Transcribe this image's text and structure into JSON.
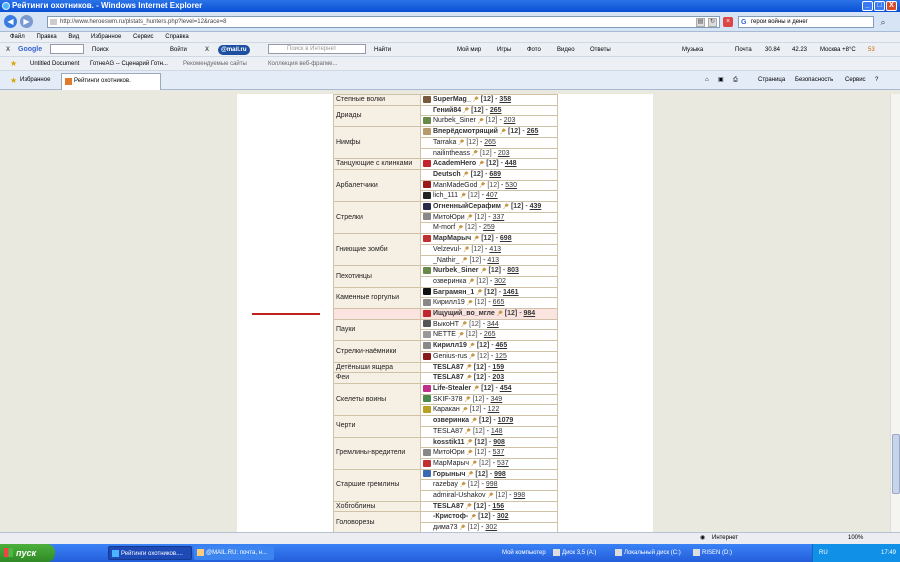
{
  "window": {
    "title": "Рейтинги охотников. - Windows Internet Explorer",
    "min": "_",
    "max": "□",
    "close": "X"
  },
  "address": {
    "url": "http://www.heroeswm.ru/plstats_hunters.php?level=12&race=8",
    "search_value": "герои войны и денег",
    "search_engine_glyph": "G"
  },
  "menu": [
    "Файл",
    "Правка",
    "Вид",
    "Избранное",
    "Сервис",
    "Справка"
  ],
  "toolbar1": {
    "close_glyph": "X",
    "google": "Google",
    "poisk": "Поиск",
    "voiti": "Войти",
    "mailru": "@mail.ru",
    "search_placeholder": "Поиск в Интернет",
    "naiti": "Найти",
    "moi_mir": "Мой мир",
    "igry": "Игры",
    "foto": "Фото",
    "video": "Видео",
    "otvety": "Ответы"
  },
  "toolbar2": {
    "muzyka": "Музыка",
    "pochta": "Почта",
    "temp1": "30.84",
    "temp2": "42.23",
    "moskva": "Москва +8°C",
    "num": "53"
  },
  "bookmarks": [
    "Untitled Document",
    "ГотнеАG -- Сценарий Готн...",
    "Рекомендуемые сайты",
    "Коллекция веб-фрагме..."
  ],
  "tabs": {
    "favorites": "Избранное",
    "active": "Рейтинги охотников.",
    "page": "Страница",
    "security": "Безопасность",
    "service": "Сервис"
  },
  "rows": [
    {
      "cls": "Степные волки",
      "nm": "SuperMag_",
      "lv": "[12]",
      "sc": "358",
      "bold": true,
      "span": 1,
      "av": "#7a5a3a"
    },
    {
      "cls": "Дриады",
      "nm": "Гений84",
      "lv": "[12]",
      "sc": "265",
      "bold": true,
      "span": 2,
      "av": ""
    },
    {
      "nm": "Nurbek_Siner",
      "lv": "[12]",
      "sc": "203",
      "bold": false,
      "av": "#6a8a4a"
    },
    {
      "cls": "Нимфы",
      "nm": "Вперёдсмотрящий",
      "lv": "[12]",
      "sc": "265",
      "bold": true,
      "span": 3,
      "av": "#b99a6a"
    },
    {
      "nm": "Tarraka",
      "lv": "[12]",
      "sc": "265",
      "bold": false,
      "av": ""
    },
    {
      "nm": "nailintheass",
      "lv": "[12]",
      "sc": "203",
      "bold": false,
      "av": ""
    },
    {
      "cls": "Танцующие с клинками",
      "nm": "AcademHero",
      "lv": "[12]",
      "sc": "448",
      "bold": true,
      "span": 1,
      "av": "#c0242c"
    },
    {
      "cls": "Арбалетчики",
      "nm": "Deutsch",
      "lv": "[12]",
      "sc": "689",
      "bold": true,
      "span": 3,
      "av": ""
    },
    {
      "nm": "ManMadeGod",
      "lv": "[12]",
      "sc": "530",
      "bold": false,
      "av": "#9a1a1a"
    },
    {
      "nm": "lich_111",
      "lv": "[12]",
      "sc": "407",
      "bold": false,
      "av": "#222222"
    },
    {
      "cls": "Стрелки",
      "nm": "ОгненныйСерафим",
      "lv": "[12]",
      "sc": "439",
      "bold": true,
      "span": 3,
      "av": "#2a2a4a"
    },
    {
      "nm": "МитоЮри",
      "lv": "[12]",
      "sc": "337",
      "bold": false,
      "av": "#888888"
    },
    {
      "nm": "M-morf",
      "lv": "[12]",
      "sc": "259",
      "bold": false,
      "av": ""
    },
    {
      "cls": "Гниющие зомби",
      "nm": "МарМарыч",
      "lv": "[12]",
      "sc": "698",
      "bold": true,
      "span": 3,
      "av": "#c03030"
    },
    {
      "nm": "Velzevul-",
      "lv": "[12]",
      "sc": "413",
      "bold": false,
      "av": ""
    },
    {
      "nm": "_Nathir_",
      "lv": "[12]",
      "sc": "413",
      "bold": false,
      "av": ""
    },
    {
      "cls": "Пехотинцы",
      "nm": "Nurbek_Siner",
      "lv": "[12]",
      "sc": "803",
      "bold": true,
      "span": 2,
      "av": "#6a8a4a"
    },
    {
      "nm": "озверинка",
      "lv": "[12]",
      "sc": "302",
      "bold": false,
      "av": ""
    },
    {
      "cls": "Каменные горгульи",
      "nm": "Баграмян_1",
      "lv": "[12]",
      "sc": "1461",
      "bold": true,
      "span": 2,
      "av": "#111111"
    },
    {
      "nm": "Кирилл19",
      "lv": "[12]",
      "sc": "665",
      "bold": false,
      "av": "#888888"
    },
    {
      "cls": "",
      "nm": "Ищущий_во_мгле",
      "lv": "[12]",
      "sc": "984",
      "bold": true,
      "span": 1,
      "av": "#c0242c",
      "hl": true
    },
    {
      "cls": "Пауки",
      "nm": "ВыкоНТ",
      "lv": "[12]",
      "sc": "344",
      "bold": false,
      "span": 2,
      "av": "#555555"
    },
    {
      "nm": "NETTE",
      "lv": "[12]",
      "sc": "265",
      "bold": false,
      "av": "#999999"
    },
    {
      "cls": "Стрелки-наёмники",
      "nm": "Кирилл19",
      "lv": "[12]",
      "sc": "465",
      "bold": true,
      "span": 2,
      "av": "#888888"
    },
    {
      "nm": "Genius-rus",
      "lv": "[12]",
      "sc": "125",
      "bold": false,
      "av": "#8a1a1a"
    },
    {
      "cls": "Детёныши ящера",
      "nm": "TESLA87",
      "lv": "[12]",
      "sc": "159",
      "bold": true,
      "span": 1,
      "av": ""
    },
    {
      "cls": "Феи",
      "nm": "TESLA87",
      "lv": "[12]",
      "sc": "203",
      "bold": true,
      "span": 1,
      "av": ""
    },
    {
      "cls": "Скелеты воины",
      "nm": "Life-Stealer",
      "lv": "[12]",
      "sc": "454",
      "bold": true,
      "span": 3,
      "av": "#c0308a"
    },
    {
      "nm": "SKIF-378",
      "lv": "[12]",
      "sc": "349",
      "bold": false,
      "av": "#4a8a4a"
    },
    {
      "nm": "Каракан",
      "lv": "[12]",
      "sc": "122",
      "bold": false,
      "av": "#b8a020"
    },
    {
      "cls": "Черти",
      "nm": "озверинка",
      "lv": "[12]",
      "sc": "1079",
      "bold": true,
      "span": 2,
      "av": ""
    },
    {
      "nm": "TESLA87",
      "lv": "[12]",
      "sc": "148",
      "bold": false,
      "av": ""
    },
    {
      "cls": "Гремлины-вредители",
      "nm": "kosstik11",
      "lv": "[12]",
      "sc": "908",
      "bold": true,
      "span": 3,
      "av": ""
    },
    {
      "nm": "МитоЮри",
      "lv": "[12]",
      "sc": "537",
      "bold": false,
      "av": "#888888"
    },
    {
      "nm": "МарМарыч",
      "lv": "[12]",
      "sc": "537",
      "bold": false,
      "av": "#c03030"
    },
    {
      "cls": "Старшие гремлины",
      "nm": "Горыныч",
      "lv": "[12]",
      "sc": "998",
      "bold": true,
      "span": 3,
      "av": "#3a6ab0"
    },
    {
      "nm": "razebay",
      "lv": "[12]",
      "sc": "998",
      "bold": false,
      "av": ""
    },
    {
      "nm": "admiral-Ushakov",
      "lv": "[12]",
      "sc": "998",
      "bold": false,
      "av": ""
    },
    {
      "cls": "Хобгоблины",
      "nm": "TESLA87",
      "lv": "[12]",
      "sc": "156",
      "bold": true,
      "span": 1,
      "av": ""
    },
    {
      "cls": "Головорезы",
      "nm": "-Кристоф-",
      "lv": "[12]",
      "sc": "302",
      "bold": true,
      "span": 2,
      "av": ""
    },
    {
      "nm": "дима73",
      "lv": "[12]",
      "sc": "302",
      "bold": false,
      "av": ""
    }
  ],
  "status": {
    "zone": "Интернет",
    "zoom": "100%"
  },
  "taskbar": {
    "start": "пуск",
    "tasks": [
      "Рейтинги охотников....",
      "@MAIL.RU: почта, н...",
      "Мой компьютер",
      "Диск 3,5 (A:)",
      "Локальный диск (C:)",
      "RISEN (D:)"
    ],
    "lang": "RU",
    "time": "17:49"
  },
  "colors": {
    "title_blue": "#0a4fd4",
    "row_highlight": "#fbe3df",
    "class_cell": "#f6efe3",
    "marker_red": "#c0221c"
  }
}
